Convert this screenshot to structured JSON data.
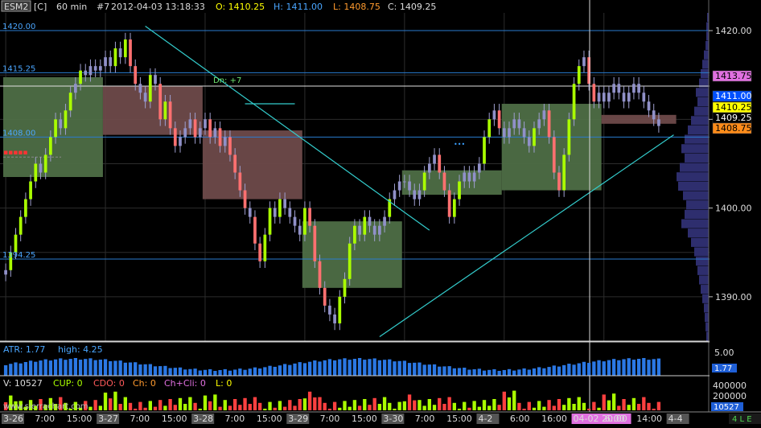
{
  "header": {
    "symbol": "ESM2",
    "flag": "[C]",
    "interval": "60 min",
    "chart_no": "#7",
    "datetime": "2012-04-03 13:18:33",
    "o_label": "O: 1410.25",
    "h_label": "H: 1411.00",
    "l_label": "L: 1408.75",
    "c_label": "C: 1409.25"
  },
  "colors": {
    "background": "#000000",
    "grid": "#2c2c2c",
    "up_candle": "#aaff00",
    "down_candle": "#ff7070",
    "neutral_candle": "#9090c8",
    "hline": "#2a7bd0",
    "trendline": "#33cccc",
    "green_box": "#4e6e46",
    "red_box": "#6e4a4a",
    "atr_bars": "#2b78e4",
    "profile": "#2e2e6e"
  },
  "price_axis": {
    "ticks": [
      "1420.00",
      "1410.00",
      "1400.00",
      "1390.00"
    ],
    "badges": [
      {
        "label": "1413.75",
        "bg": "#e070e0",
        "fg": "#000000",
        "price": 1413.75
      },
      {
        "label": "1411.00",
        "bg": "#0050ff",
        "fg": "#ffffff",
        "price": 1411.0
      },
      {
        "label": "1410.25",
        "bg": "#ffff00",
        "fg": "#000000",
        "price": 1410.25
      },
      {
        "label": "1409.25",
        "bg": "#000000",
        "fg": "#ffffff",
        "price": 1409.25
      },
      {
        "label": "1408.75",
        "bg": "#ff8c1a",
        "fg": "#000000",
        "price": 1408.75
      }
    ]
  },
  "level_labels": [
    {
      "label": "1420.00",
      "price": 1420.0
    },
    {
      "label": "1415.25",
      "price": 1415.25
    },
    {
      "label": "1408.00",
      "price": 1408.0
    },
    {
      "label": "1394.25",
      "price": 1394.25
    }
  ],
  "annotation": "Dn: +7",
  "atr_panel": {
    "label": "ATR: 1.77",
    "high_label": "high: 4.25",
    "tick": "5.00",
    "badge": "1.77"
  },
  "volume_panel": {
    "v": "V: 10527",
    "cup": "CUP: 0",
    "cdo": "CDO: 0",
    "ch": "Ch: 0",
    "chcli": "Ch+Cli: 0",
    "l": "L: 0",
    "ticks": [
      "400000",
      "200000"
    ],
    "badge": "10527",
    "watermark": "www.sierrachart.com"
  },
  "time_axis": {
    "labels": [
      "3-26",
      "7:00",
      "15:00",
      "3-27",
      "7:00",
      "15:00",
      "3-28",
      "7:00",
      "15:00",
      "3-29",
      "7:00",
      "15:00",
      "3-30",
      "7:00",
      "15:00",
      "4-2",
      "6:00",
      "16:00",
      "04-02  20:00",
      "6:00",
      "14:00",
      "4-4"
    ],
    "status": "4 L E"
  },
  "chart_data": {
    "type": "candlestick",
    "ylim": [
      1385,
      1422
    ],
    "horizontal_levels": [
      1420.0,
      1415.25,
      1408.0,
      1394.25,
      1413.75
    ],
    "boxes": [
      {
        "color": "green",
        "from_bar": 0,
        "to_bar": 19,
        "low": 1403.5,
        "high": 1414.75
      },
      {
        "color": "red",
        "from_bar": 20,
        "to_bar": 39,
        "low": 1408.25,
        "high": 1413.75
      },
      {
        "color": "red",
        "from_bar": 40,
        "to_bar": 59,
        "low": 1401.0,
        "high": 1408.75
      },
      {
        "color": "green",
        "from_bar": 60,
        "to_bar": 79,
        "low": 1391.0,
        "high": 1398.5
      },
      {
        "color": "green",
        "from_bar": 80,
        "to_bar": 99,
        "low": 1401.5,
        "high": 1404.25
      },
      {
        "color": "green",
        "from_bar": 100,
        "to_bar": 119,
        "low": 1402.0,
        "high": 1411.75
      },
      {
        "color": "red",
        "from_bar": 120,
        "to_bar": 134,
        "low": 1409.5,
        "high": 1410.5
      }
    ],
    "trendlines": [
      {
        "from_bar": 28,
        "from_price": 1420.5,
        "to_bar": 85,
        "to_price": 1397.5
      },
      {
        "from_bar": 75,
        "from_price": 1385.5,
        "to_bar": 134,
        "to_price": 1408.25
      },
      {
        "from_bar": 48,
        "from_price": 1411.75,
        "to_bar": 58,
        "to_price": 1411.75
      }
    ],
    "closes": [
      1393,
      1395,
      1397,
      1399,
      1401,
      1403,
      1405,
      1404,
      1406,
      1408,
      1410,
      1409,
      1411,
      1413,
      1414,
      1415.5,
      1415,
      1416,
      1415.5,
      1416,
      1417,
      1416,
      1418,
      1417,
      1419,
      1416,
      1414,
      1413,
      1412,
      1415,
      1414,
      1410,
      1412,
      1409,
      1407,
      1408,
      1409,
      1410,
      1408,
      1409,
      1410,
      1408,
      1409,
      1407,
      1408,
      1406,
      1404,
      1402,
      1400,
      1399,
      1396,
      1394,
      1397,
      1400,
      1399,
      1401,
      1400,
      1399,
      1398,
      1397,
      1400,
      1398,
      1394,
      1391,
      1389,
      1388,
      1387,
      1390,
      1392,
      1396,
      1398,
      1397,
      1399,
      1398,
      1397,
      1398,
      1399,
      1401,
      1402,
      1403,
      1403,
      1402,
      1401,
      1402,
      1404,
      1405,
      1406,
      1404,
      1402,
      1399,
      1401,
      1403,
      1404,
      1403,
      1404,
      1405,
      1408,
      1410,
      1411,
      1409,
      1408,
      1409,
      1410,
      1409,
      1408,
      1407,
      1409,
      1410,
      1411,
      1408,
      1404,
      1402,
      1406,
      1410,
      1414,
      1416,
      1417,
      1414,
      1412,
      1413,
      1412,
      1413,
      1414,
      1413,
      1412,
      1413,
      1414,
      1413,
      1412,
      1411,
      1410,
      1409.25
    ]
  }
}
